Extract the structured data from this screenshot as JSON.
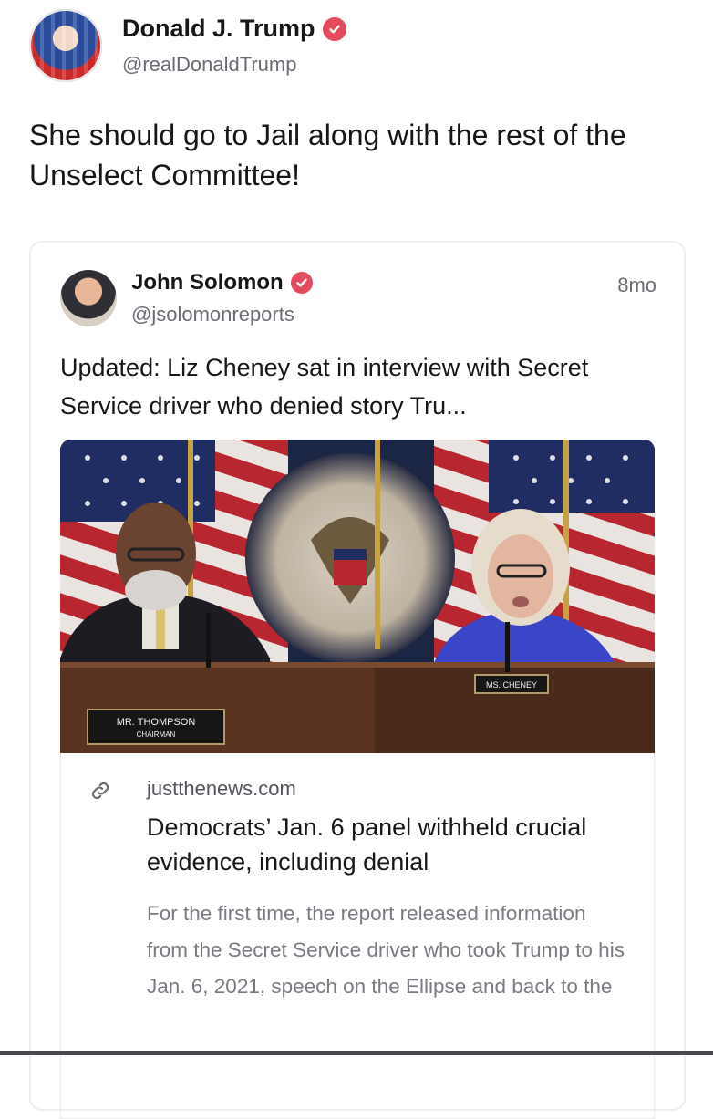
{
  "post": {
    "author_name": "Donald J. Trump",
    "author_handle": "@realDonaldTrump",
    "text": "She should go to Jail along with the rest of the Unselect Committee!"
  },
  "quote": {
    "author_name": "John Solomon",
    "author_handle": "@jsolomonreports",
    "timestamp": "8mo",
    "text": "Updated: Liz Cheney sat in interview with Secret Service driver who denied story Tru...",
    "image": {
      "left_nameplate": "MR. THOMPSON",
      "left_nameplate_sub": "CHAIRMAN",
      "right_nameplate": "MS. CHENEY"
    },
    "link": {
      "domain": "justthenews.com",
      "title": "Democrats’ Jan. 6 panel withheld crucial evidence, including denial",
      "description": "For the first time, the report released information from the Secret Service driver who took Trump to his Jan. 6, 2021, speech on the Ellipse and back to the"
    }
  },
  "icons": {
    "verified": "verified-badge-icon",
    "link": "link-chain-icon"
  },
  "colors": {
    "verified_badge": "#e44b5f",
    "text_primary": "#17171a",
    "text_secondary": "#6b6b74"
  }
}
